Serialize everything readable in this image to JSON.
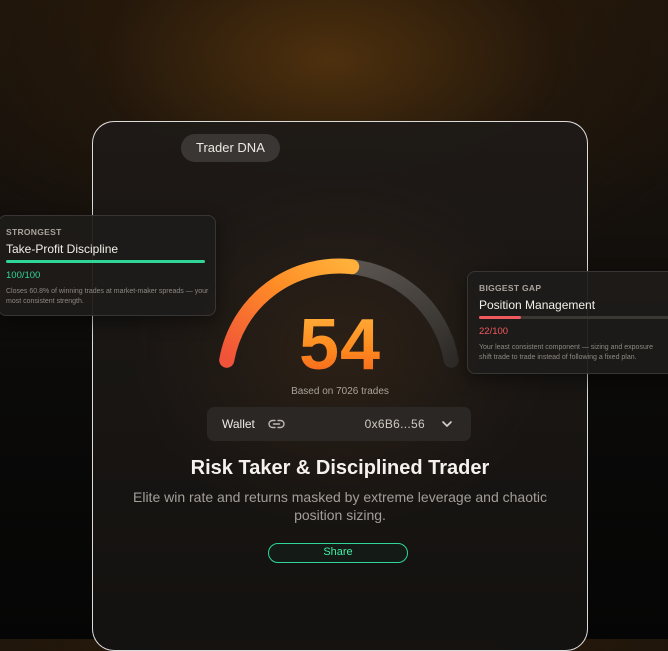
{
  "badge": "Trader DNA",
  "score": {
    "value": "54",
    "caption": "Based on 7026 trades",
    "gauge_fraction": 0.54
  },
  "wallet": {
    "label": "Wallet",
    "address": "0x6B6...56",
    "link_icon": "link-icon",
    "chevron_icon": "chevron-down-icon"
  },
  "profile": {
    "headline": "Risk Taker & Disciplined Trader",
    "description": "Elite win rate and returns masked by extreme leverage and chaotic position sizing."
  },
  "share_label": "Share",
  "strongest": {
    "kicker": "STRONGEST",
    "title": "Take-Profit Discipline",
    "score": "100/100",
    "fraction": 1.0,
    "note": "Closes 60.8% of winning trades at market-maker spreads — your most consistent strength."
  },
  "gap": {
    "kicker": "BIGGEST GAP",
    "title": "Position Management",
    "score": "22/100",
    "fraction": 0.22,
    "note_line1": "Your least consistent component — sizing and exposure",
    "note_line2": "shift trade to trade instead of following a fixed plan."
  },
  "colors": {
    "accent_green": "#2fd695",
    "accent_red": "#f0595e",
    "gauge_start": "#f0523a",
    "gauge_end": "#ffb03a",
    "gauge_track": "#4a4642"
  }
}
